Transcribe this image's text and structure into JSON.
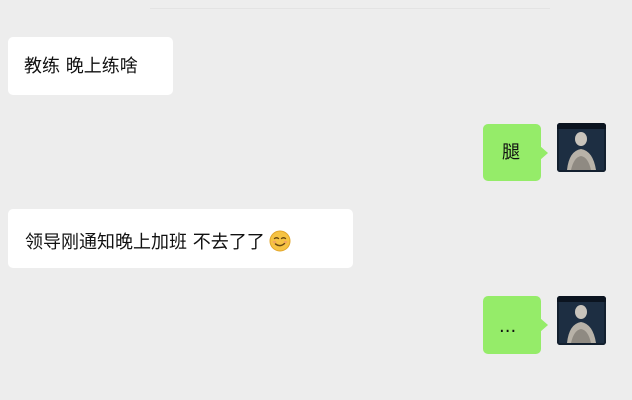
{
  "messages": [
    {
      "direction": "incoming",
      "text": "教练 晚上练啥"
    },
    {
      "direction": "outgoing",
      "text": "腿"
    },
    {
      "direction": "incoming",
      "text": "领导刚通知晚上加班 不去了了",
      "emoji": "smirk-face-emoji"
    },
    {
      "direction": "outgoing",
      "text": "..."
    }
  ],
  "colors": {
    "background": "#ededed",
    "incoming_bubble": "#ffffff",
    "outgoing_bubble": "#95ec69"
  }
}
